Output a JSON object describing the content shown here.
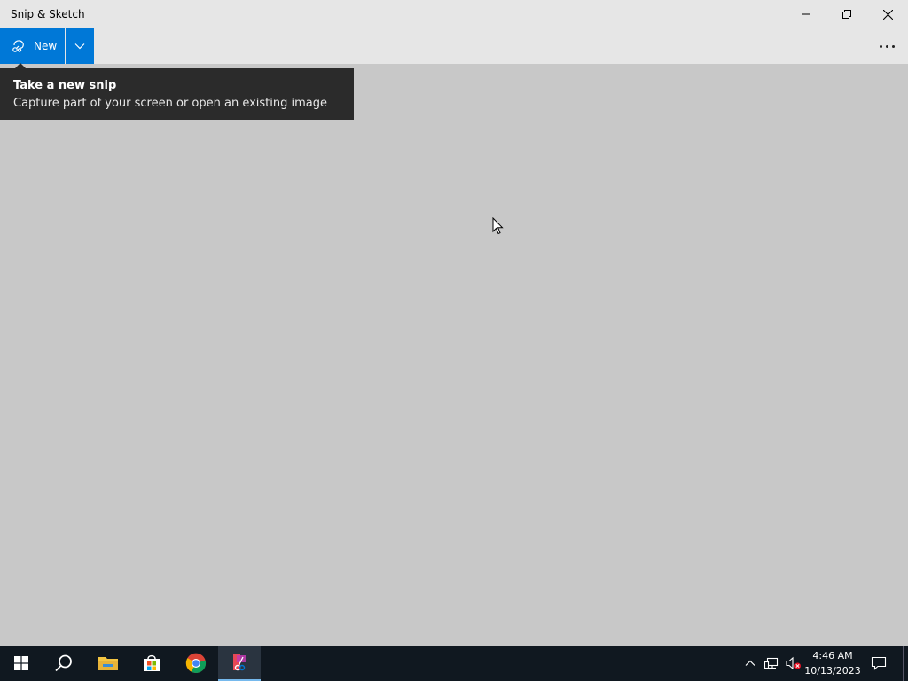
{
  "window": {
    "title": "Snip & Sketch"
  },
  "toolbar": {
    "new_label": "New"
  },
  "tooltip": {
    "title": "Take a new snip",
    "description": "Capture part of your screen or open an existing image"
  },
  "taskbar": {
    "items": [
      "start-icon",
      "search-icon",
      "file-explorer-icon",
      "store-icon",
      "chrome-icon",
      "snip-sketch-icon"
    ],
    "time": "4:46 AM",
    "date": "10/13/2023"
  },
  "colors": {
    "accent": "#0078d7",
    "titlebar": "#e6e6e6",
    "canvas": "#c8c8c8",
    "tooltip": "#2b2b2b",
    "taskbar": "#101820"
  }
}
